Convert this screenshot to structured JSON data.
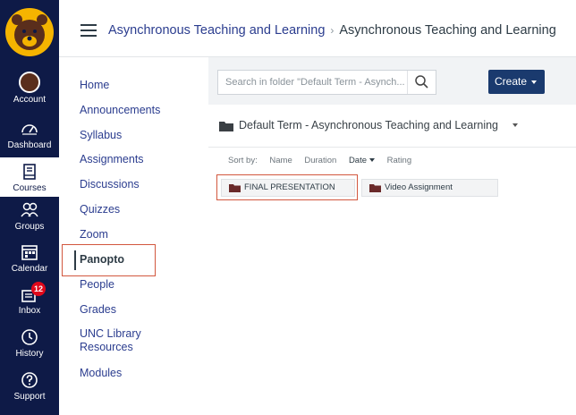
{
  "global_nav": {
    "items": [
      {
        "label": "Account",
        "icon": "avatar"
      },
      {
        "label": "Dashboard",
        "icon": "dashboard-icon"
      },
      {
        "label": "Courses",
        "icon": "courses-icon",
        "active": true
      },
      {
        "label": "Groups",
        "icon": "groups-icon"
      },
      {
        "label": "Calendar",
        "icon": "calendar-icon"
      },
      {
        "label": "Inbox",
        "icon": "inbox-icon",
        "badge": "12"
      },
      {
        "label": "History",
        "icon": "history-icon"
      },
      {
        "label": "Support",
        "icon": "help-icon"
      }
    ],
    "colors": {
      "background": "#0e1a47",
      "badge": "#e0081b"
    }
  },
  "header": {
    "breadcrumb": [
      "Asynchronous Teaching and Learning",
      "Asynchronous Teaching and Learning"
    ]
  },
  "course_nav": {
    "items": [
      "Home",
      "Announcements",
      "Syllabus",
      "Assignments",
      "Discussions",
      "Quizzes",
      "Zoom",
      "Panopto",
      "People",
      "Grades",
      "UNC Library Resources",
      "Modules"
    ],
    "active": "Panopto"
  },
  "panopto": {
    "search_placeholder": "Search in folder \"Default Term - Asynch...",
    "create_label": "Create",
    "folder_title": "Default Term - Asynchronous Teaching and Learning",
    "sort_by_label": "Sort by:",
    "sort_options": [
      "Name",
      "Duration",
      "Date",
      "Rating"
    ],
    "sort_active": "Date",
    "folders": [
      "FINAL PRESENTATION",
      "Video Assignment"
    ],
    "colors": {
      "create_button": "#1a3a6e",
      "highlight": "#d2573e"
    }
  }
}
